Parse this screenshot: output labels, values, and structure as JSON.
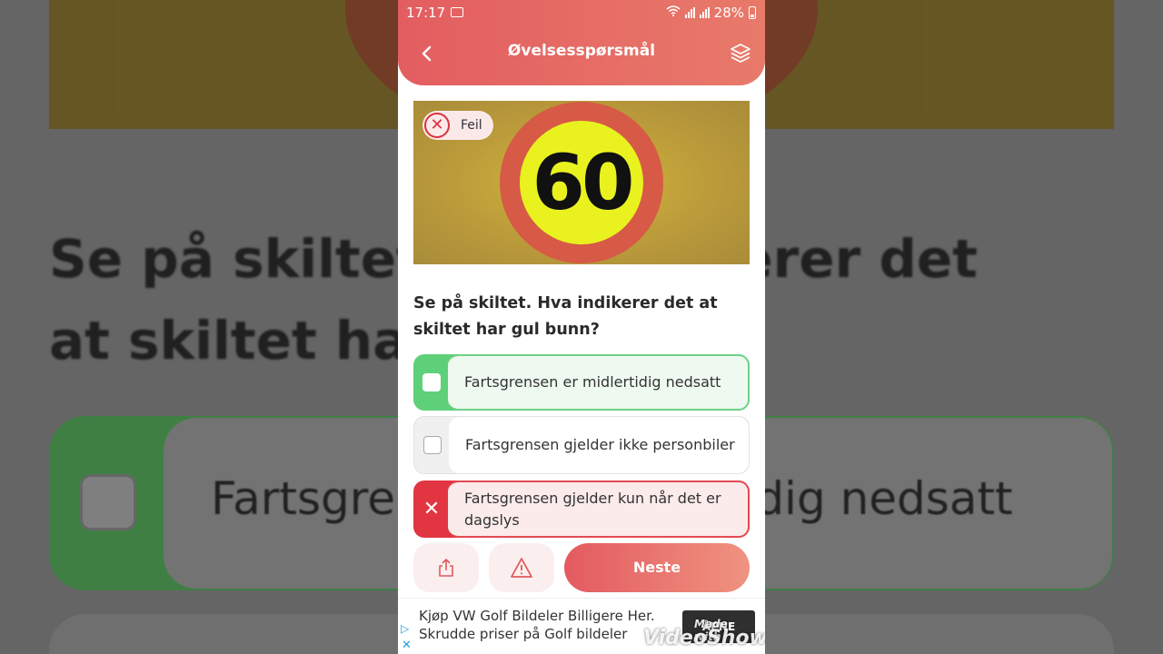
{
  "background": {
    "question_echo": "Se på skiltet. Hva indikerer det at skiltet har gul bunn?",
    "option_echo": "Fartsgrensen er midlertidig nedsatt"
  },
  "status_bar": {
    "time": "17:17",
    "battery": "28%"
  },
  "header": {
    "title": "Øvelsesspørsmål",
    "back_icon": "chevron-left-icon",
    "layers_icon": "layers-icon"
  },
  "image": {
    "sign_number": "60",
    "badge_label": "Feil"
  },
  "question": "Se på skiltet. Hva indikerer det at skiltet har gul bunn?",
  "options": [
    {
      "label": "Fartsgrensen er midlertidig nedsatt",
      "state": "correct"
    },
    {
      "label": "Fartsgrensen gjelder ikke personbiler",
      "state": "neutral"
    },
    {
      "label": "Fartsgrensen gjelder kun når det er dagslys",
      "state": "wrong"
    }
  ],
  "actions": {
    "share_icon": "share-icon",
    "report_icon": "warning-icon",
    "next_label": "Neste"
  },
  "ad": {
    "line1": "Kjøp VW Golf Bildeler Billigere Her.",
    "line2": "Skrudde priser på Golf bildeler",
    "cta": "ÅPNE"
  },
  "watermark": {
    "small": "Made with",
    "big": "VideoShow"
  },
  "colors": {
    "accent": "#e35d60",
    "correct": "#5fd07a",
    "wrong": "#e23542"
  }
}
